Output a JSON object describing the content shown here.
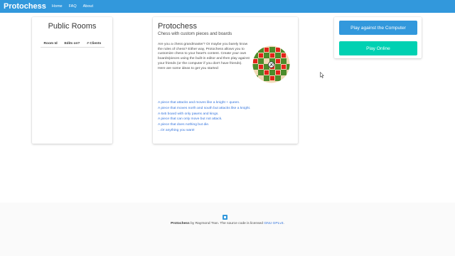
{
  "navbar": {
    "brand": "Protochess",
    "links": [
      "Home",
      "FAQ",
      "About"
    ]
  },
  "rooms": {
    "title": "Public Rooms",
    "columns": [
      "Room Id",
      "Edits on?",
      "# Clients"
    ]
  },
  "intro": {
    "title": "Protochess",
    "subtitle": "Chess with custom pieces and boards",
    "description": "Are you a chess grandmaster? Or maybe you barely know the rules of chess? Either way, Protochess allows you to customize chess to your heart's content. Create your own boards/pieces using the built-in editor and then play against your friends (or the computer if you don't have friends). Here are some ideas to get you started:",
    "ideas": [
      "A piece that attacks and moves like a knight + queen.",
      "A piece that moves north and south but attacks like a knight.",
      "A 6x5 board with only pawns and kings.",
      "A piece that can only move but not attack.",
      "A piece that does nothing but die.",
      "...Or anything you want!"
    ]
  },
  "play": {
    "computer_label": "Play against the Computer",
    "online_label": "Play Online"
  },
  "footer": {
    "brand": "Protochess",
    "by_text": " by Raymond Tran. The source code is licensed ",
    "license": "GNU GPLv3",
    "end": "."
  },
  "colors": {
    "primary": "#3298dc",
    "success": "#00d1b2",
    "link": "#3273dc",
    "logo_light": "#f0d9b5",
    "logo_green": "#4c8c2b",
    "logo_red": "#e2231a"
  }
}
